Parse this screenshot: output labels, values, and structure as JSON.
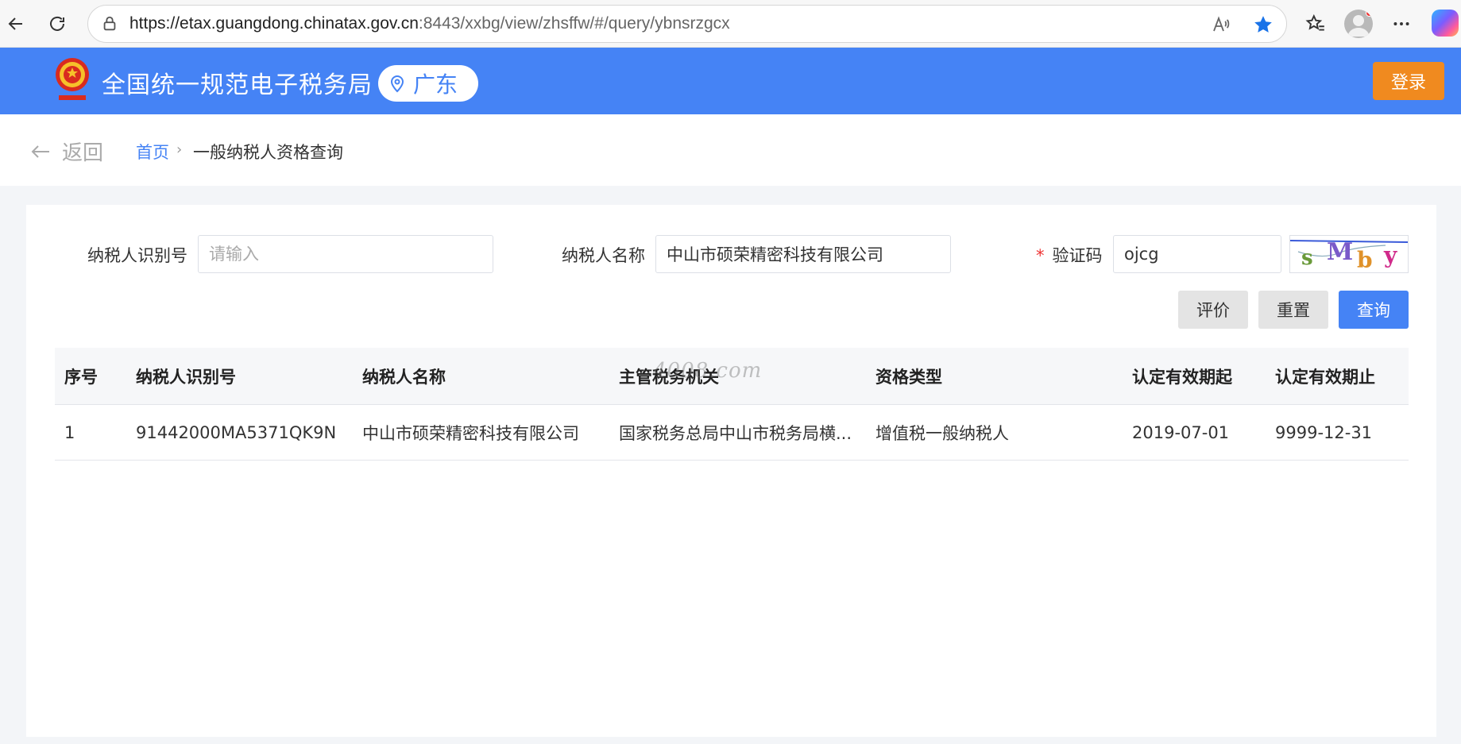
{
  "browser": {
    "url_host": "https://etax.guangdong.chinatax.gov.cn",
    "url_path": ":8443/xxbg/view/zhsffw/#/query/ybnsrzgcx"
  },
  "header": {
    "site_title": "全国统一规范电子税务局",
    "region": "广东",
    "login_label": "登录"
  },
  "breadcrumb": {
    "back_label": "返回",
    "home": "首页",
    "separator": "›",
    "current": "一般纳税人资格查询"
  },
  "form": {
    "taxpayer_id_label": "纳税人识别号",
    "taxpayer_id_placeholder": "请输入",
    "taxpayer_id_value": "",
    "taxpayer_name_label": "纳税人名称",
    "taxpayer_name_value": "中山市硕荣精密科技有限公司",
    "required_mark": "*",
    "captcha_label": "验证码",
    "captcha_value": "ojcg",
    "captcha_image_text": "sMby"
  },
  "buttons": {
    "evaluate": "评价",
    "reset": "重置",
    "query": "查询"
  },
  "table": {
    "columns": [
      "序号",
      "纳税人识别号",
      "纳税人名称",
      "主管税务机关",
      "资格类型",
      "认定有效期起",
      "认定有效期止"
    ],
    "rows": [
      [
        "1",
        "91442000MA5371QK9N",
        "中山市硕荣精密科技有限公司",
        "国家税务总局中山市税务局横...",
        "增值税一般纳税人",
        "2019-07-01",
        "9999-12-31"
      ]
    ]
  },
  "watermark": "4008.com",
  "colors": {
    "header_bg": "#4583f5",
    "login_btn": "#f08a1f",
    "primary": "#4583f5"
  }
}
